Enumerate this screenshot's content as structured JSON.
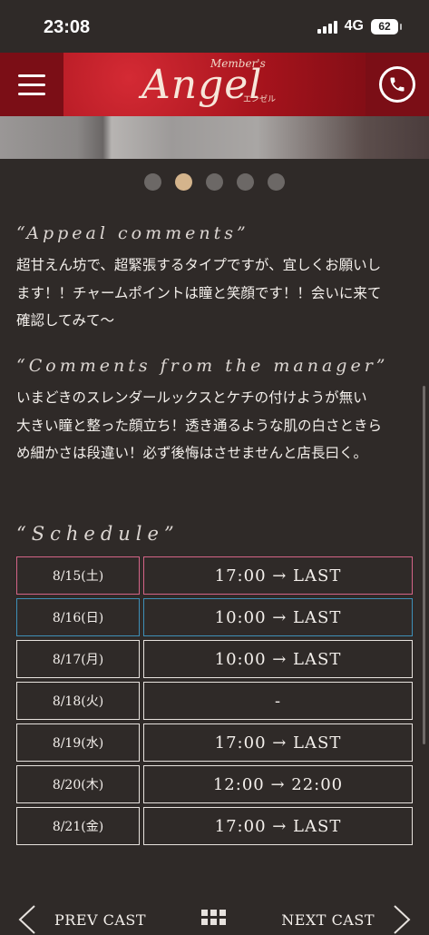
{
  "status": {
    "time": "23:08",
    "network": "4G",
    "battery": "62"
  },
  "header": {
    "logo_small": "Member's",
    "logo_main": "Angel",
    "logo_kana": "エンゼル"
  },
  "carousel": {
    "count": 5,
    "active_index": 1
  },
  "appeal": {
    "title": "“Appeal comments”",
    "lines": [
      "超甘えん坊で、超緊張するタイプですが、宜しくお願いし",
      "ます！！チャームポイントは瞳と笑顔です！！会いに来て",
      "確認してみて〜"
    ]
  },
  "manager": {
    "title": "“Comments from the manager”",
    "lines": [
      "いまどきのスレンダールックスとケチの付けようが無い",
      "大きい瞳と整った顔立ち！透き通るような肌の白さときら",
      "め細かさは段違い！必ず後悔はさせませんと店長曰く。"
    ]
  },
  "schedule": {
    "title": "“Schedule”",
    "rows": [
      {
        "date": "8/15(土)",
        "time": "17:00 → LAST"
      },
      {
        "date": "8/16(日)",
        "time": "10:00 → LAST"
      },
      {
        "date": "8/17(月)",
        "time": "10:00 → LAST"
      },
      {
        "date": "8/18(火)",
        "time": "-"
      },
      {
        "date": "8/19(水)",
        "time": "17:00 → LAST"
      },
      {
        "date": "8/20(木)",
        "time": "12:00 → 22:00"
      },
      {
        "date": "8/21(金)",
        "time": "17:00 → LAST"
      }
    ]
  },
  "nav": {
    "prev": "PREV CAST",
    "next": "NEXT CAST"
  },
  "colors": {
    "saturday": "#d46487",
    "sunday": "#3e8fb7",
    "accent_dot": "#d4b48c",
    "header_red": "#a5131c"
  }
}
